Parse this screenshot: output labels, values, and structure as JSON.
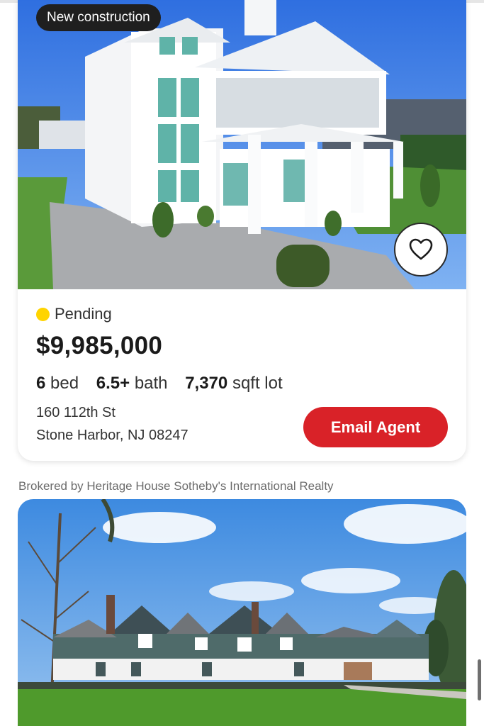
{
  "listing1": {
    "tag": "New construction",
    "status": "Pending",
    "price": "$9,985,000",
    "beds": "6",
    "beds_unit": "bed",
    "baths": "6.5+",
    "baths_unit": "bath",
    "lot": "7,370",
    "lot_unit": "sqft lot",
    "address_line1": "160 112th St",
    "address_line2": "Stone Harbor, NJ 08247",
    "cta_label": "Email Agent",
    "favorite_icon": "heart-outline-icon"
  },
  "broker_text": "Brokered by Heritage House Sotheby's International Realty",
  "listing2": {
    "photo": "house-photo"
  },
  "colors": {
    "cta": "#d92228",
    "status_pending": "#ffd400",
    "tag_bg": "#1f1f1f"
  }
}
